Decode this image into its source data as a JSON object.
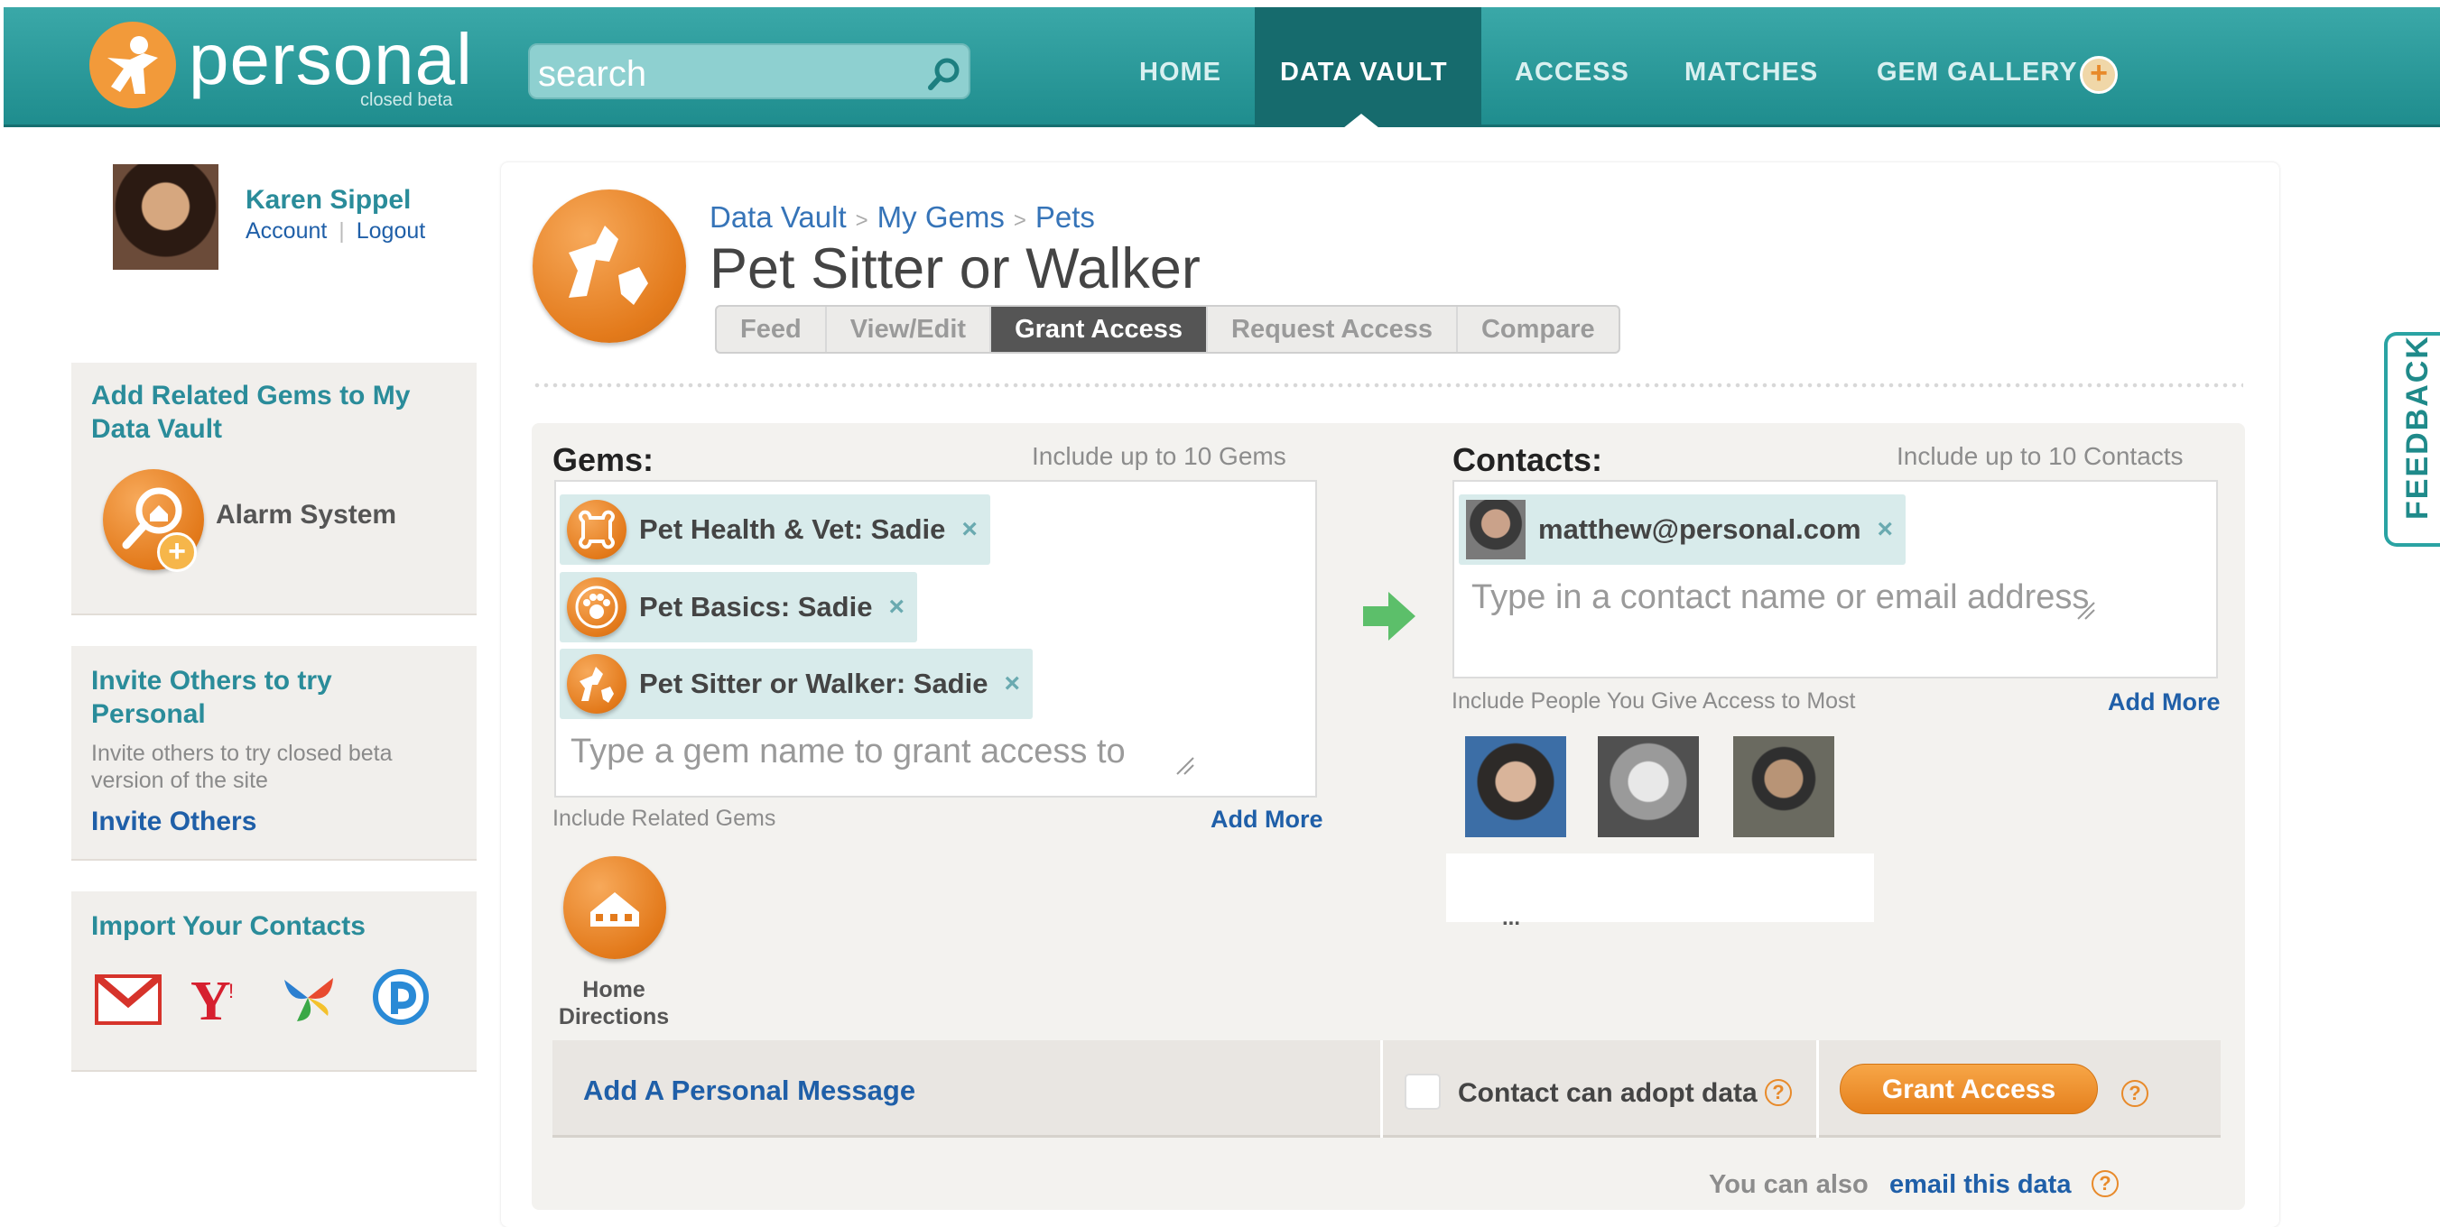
{
  "header": {
    "logo_text": "personal",
    "logo_sub": "closed beta",
    "search_placeholder": "search",
    "nav": [
      "HOME",
      "DATA VAULT",
      "ACCESS",
      "MATCHES",
      "GEM GALLERY"
    ]
  },
  "user": {
    "name": "Karen Sippel",
    "account": "Account",
    "logout": "Logout"
  },
  "sidebar": {
    "related": {
      "title_line1": "Add Related Gems to My",
      "title_line2": "Data Vault",
      "gem": "Alarm System"
    },
    "invite": {
      "title_line1": "Invite Others to try",
      "title_line2": "Personal",
      "desc_line1": "Invite others to try closed beta",
      "desc_line2": "version of the site",
      "link": "Invite Others"
    },
    "import": {
      "title": "Import Your Contacts",
      "services": [
        "gmail-icon",
        "yahoo-icon",
        "msn-icon",
        "plaxo-icon"
      ]
    }
  },
  "page": {
    "breadcrumb": [
      "Data Vault",
      "My Gems",
      "Pets"
    ],
    "title": "Pet Sitter or Walker",
    "tabs": [
      "Feed",
      "View/Edit",
      "Grant Access",
      "Request Access",
      "Compare"
    ],
    "active_tab": "Grant Access"
  },
  "gems": {
    "heading": "Gems:",
    "limit": "Include up to 10 Gems",
    "tokens": [
      "Pet Health & Vet: Sadie",
      "Pet Basics: Sadie",
      "Pet Sitter or Walker: Sadie"
    ],
    "remove": "×",
    "placeholder": "Type a gem name to grant access to",
    "related_label": "Include Related Gems",
    "add_more": "Add More",
    "related_gem_line1": "Home",
    "related_gem_line2": "Directions"
  },
  "contacts": {
    "heading": "Contacts:",
    "limit": "Include up to 10 Contacts",
    "tokens": [
      "matthew@personal.com"
    ],
    "remove": "×",
    "placeholder": "Type in a contact name or email address",
    "frequent_label": "Include People You Give Access to Most",
    "add_more": "Add More",
    "ellipsis": "..."
  },
  "actions": {
    "personal_message": "Add A Personal Message",
    "adopt_label": "Contact can adopt data",
    "help": "?",
    "grant_button": "Grant Access",
    "also_text": "You can also",
    "email_link": "email this data"
  },
  "feedback": "FEEDBACK",
  "colors": {
    "teal": "#1f8d8e",
    "orange": "#e5801d",
    "link": "#1f5fa8"
  }
}
